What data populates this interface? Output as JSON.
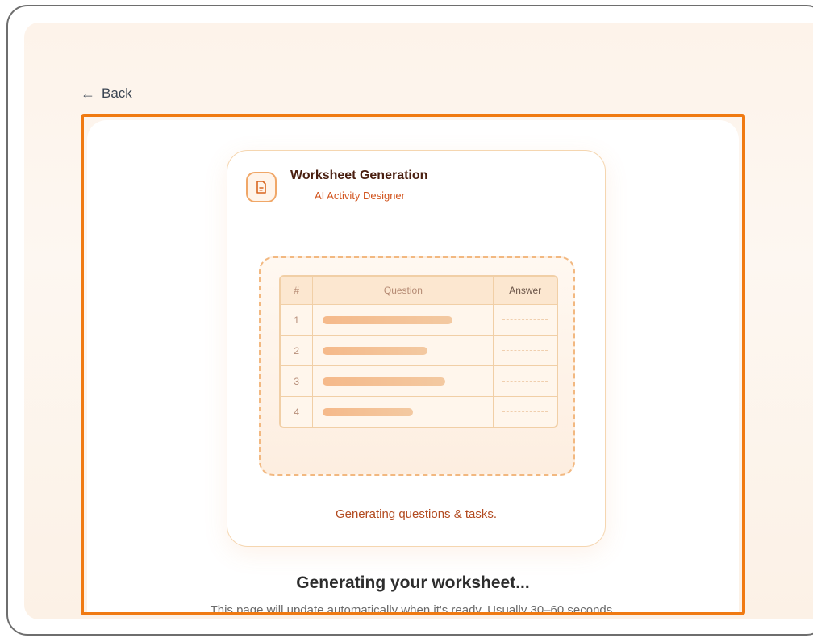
{
  "nav": {
    "back_label": "Back"
  },
  "card": {
    "title": "Worksheet Generation",
    "subtitle": "AI Activity Designer",
    "status": "Generating questions & tasks."
  },
  "table": {
    "headers": [
      "#",
      "Question",
      "Answer"
    ],
    "rows": [
      {
        "num": "1",
        "fill": 0.72
      },
      {
        "num": "2",
        "fill": 0.58
      },
      {
        "num": "3",
        "fill": 0.68
      },
      {
        "num": "4",
        "fill": 0.5
      }
    ]
  },
  "main": {
    "title": "Generating your worksheet...",
    "subtitle": "This page will update automatically when it's ready. Usually 30–60 seconds."
  },
  "colors": {
    "accent": "#f07a12",
    "title": "#4a1f10",
    "subtitle": "#d2541e",
    "bar": "#f5b98a"
  },
  "icons": {
    "back": "arrow-left-icon",
    "document": "document-icon"
  }
}
